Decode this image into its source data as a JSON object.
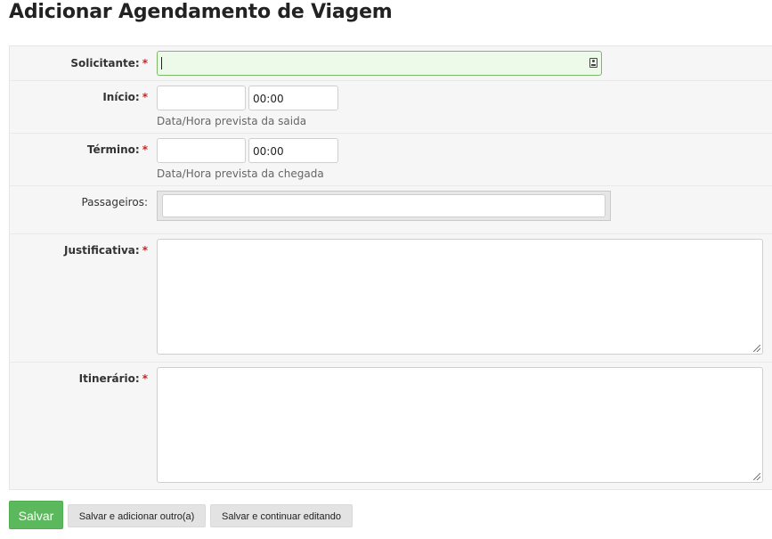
{
  "page_title": "Adicionar Agendamento de Viagem",
  "form": {
    "solicitante": {
      "label": "Solicitante:",
      "required": "*",
      "value": ""
    },
    "inicio": {
      "label": "Início:",
      "required": "*",
      "date_value": "",
      "time_value": "00:00",
      "help": "Data/Hora prevista da saida"
    },
    "termino": {
      "label": "Término:",
      "required": "*",
      "date_value": "",
      "time_value": "00:00",
      "help": "Data/Hora prevista da chegada"
    },
    "passageiros": {
      "label": "Passageiros:",
      "value": ""
    },
    "justificativa": {
      "label": "Justificativa:",
      "required": "*",
      "value": ""
    },
    "itinerario": {
      "label": "Itinerário:",
      "required": "*",
      "value": ""
    }
  },
  "actions": {
    "save": "Salvar",
    "save_add_another": "Salvar e adicionar outro(a)",
    "save_continue": "Salvar e continuar editando"
  },
  "colors": {
    "primary": "#5cb85c",
    "required": "#c02a2a",
    "focus_bg": "#eefae9"
  },
  "icons": {
    "solicitante_lookup": "id-card-icon"
  }
}
